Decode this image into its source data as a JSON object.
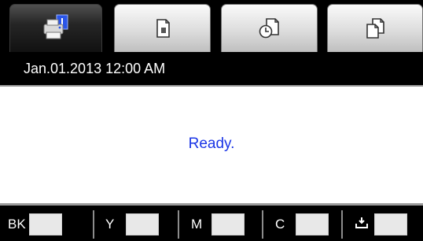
{
  "tabs": [
    {
      "name": "status-tab",
      "icon": "printer-status-icon",
      "active": true
    },
    {
      "name": "copy-tab",
      "icon": "document-icon",
      "active": false
    },
    {
      "name": "timer-tab",
      "icon": "document-clock-icon",
      "active": false
    },
    {
      "name": "copies-tab",
      "icon": "multiple-documents-icon",
      "active": false
    }
  ],
  "datetime": "Jan.01.2013 12:00 AM",
  "status_message": "Ready.",
  "inks": [
    {
      "label": "BK"
    },
    {
      "label": "Y"
    },
    {
      "label": "M"
    },
    {
      "label": "C"
    },
    {
      "label": "",
      "icon": "maintenance-box-icon"
    }
  ],
  "colors": {
    "status_text": "#1a35e6",
    "bar_background": "#000000"
  }
}
